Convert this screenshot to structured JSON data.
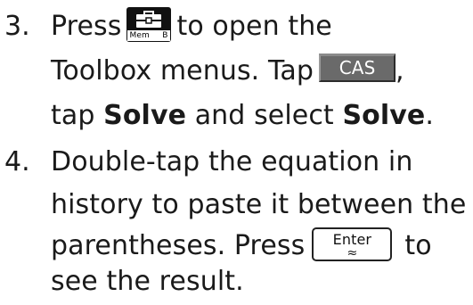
{
  "steps": [
    {
      "number": "3.",
      "press": "Press",
      "after_toolbox": "to open the",
      "line2_before_key": "Toolbox menus. Tap",
      "line2_after_key": ",",
      "line3_tap": "tap",
      "line3_solve_bold": "Solve",
      "line3_and_select": "and select",
      "line3_solve_bold2": "Solve",
      "line3_period": "."
    },
    {
      "number": "4.",
      "line1": "Double-tap the equation in",
      "line2": "history to paste it between the",
      "line3_before_key": "parentheses. Press",
      "line3_after_key": "to",
      "line4": "see the result."
    }
  ],
  "keys": {
    "toolbox": {
      "icon": "toolbox-icon",
      "label_left": "Mem",
      "label_right": "B"
    },
    "cas": {
      "label": "CAS"
    },
    "enter": {
      "label": "Enter",
      "symbol": "≈"
    }
  }
}
